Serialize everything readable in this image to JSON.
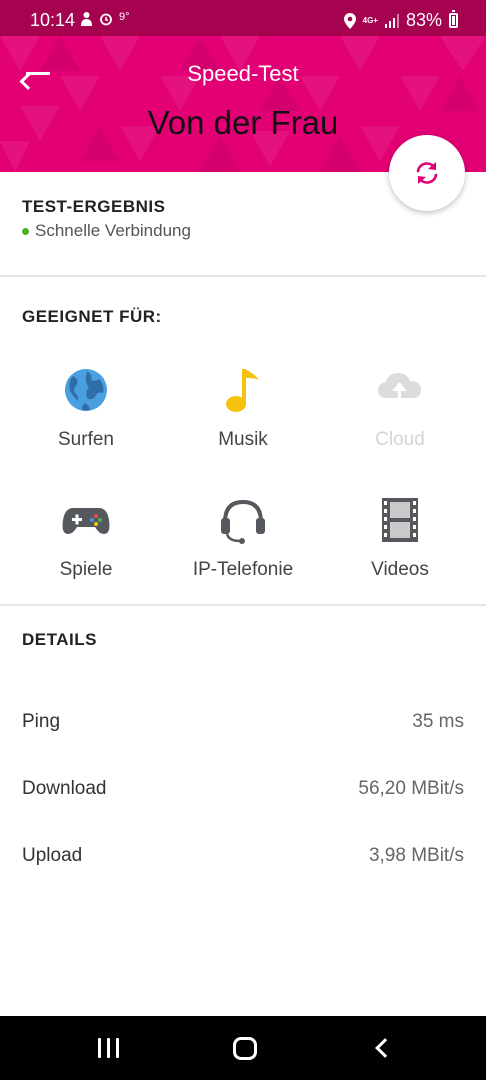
{
  "status_bar": {
    "time": "10:14",
    "temperature": "9°",
    "network": "4G+",
    "battery": "83%",
    "icons": [
      "person-icon",
      "alarm-icon",
      "location-icon",
      "signal-icon",
      "battery-icon"
    ]
  },
  "header": {
    "title": "Speed-Test",
    "name": "Von der Frau",
    "back_icon": "arrow-left-icon",
    "refresh_icon": "refresh-icon",
    "accent_color": "#e20074"
  },
  "result": {
    "title": "TEST-ERGEBNIS",
    "status": "Schnelle Verbindung",
    "status_color": "#46b21d"
  },
  "suitable": {
    "title": "GEEIGNET FÜR:",
    "items": [
      {
        "label": "Surfen",
        "icon": "globe-icon",
        "enabled": true
      },
      {
        "label": "Musik",
        "icon": "music-note-icon",
        "enabled": true
      },
      {
        "label": "Cloud",
        "icon": "cloud-upload-icon",
        "enabled": false
      },
      {
        "label": "Spiele",
        "icon": "gamepad-icon",
        "enabled": true
      },
      {
        "label": "IP-Telefonie",
        "icon": "headset-icon",
        "enabled": true
      },
      {
        "label": "Videos",
        "icon": "film-icon",
        "enabled": true
      }
    ]
  },
  "details": {
    "title": "DETAILS",
    "rows": [
      {
        "label": "Ping",
        "value": "35 ms"
      },
      {
        "label": "Download",
        "value": "56,20 MBit/s"
      },
      {
        "label": "Upload",
        "value": "3,98 MBit/s"
      }
    ]
  }
}
